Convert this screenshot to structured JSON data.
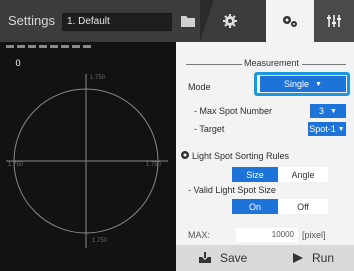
{
  "header": {
    "title": "Settings",
    "preset_value": "1. Default"
  },
  "preview": {
    "spot_count": "0",
    "axis": {
      "top": "1.750",
      "bottom": "1.750",
      "left": "1.750",
      "right": "1.750"
    }
  },
  "panel": {
    "section_title": "Measurement",
    "mode": {
      "label": "Mode",
      "value": "Single"
    },
    "max_spot": {
      "label": "- Max Spot Number",
      "value": "3"
    },
    "target": {
      "label": "- Target",
      "value": "Spot-1"
    },
    "sorting": {
      "label": "Light Spot Sorting Rules",
      "options": [
        "Size",
        "Angle"
      ],
      "selected": "Size"
    },
    "valid_size": {
      "label": "- Valid Light Spot Size",
      "options": [
        "On",
        "Off"
      ],
      "selected": "On"
    },
    "max": {
      "label": "MAX:",
      "value": "10000",
      "unit": "[pixel]"
    }
  },
  "footer": {
    "save_label": "Save",
    "run_label": "Run"
  },
  "colors": {
    "accent": "#1e73d8",
    "highlight": "#1a99e0",
    "panel_bg": "#f3f3f3",
    "dark_bg": "#121212"
  }
}
